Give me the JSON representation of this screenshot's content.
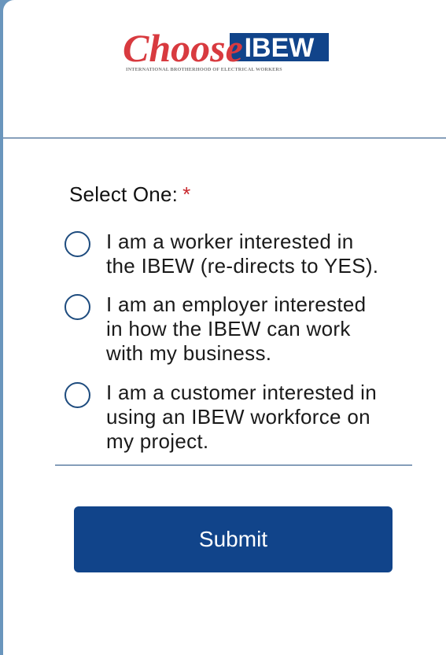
{
  "logo": {
    "script_text": "Choose",
    "brand_text": "IBEW",
    "tagline": "INTERNATIONAL BROTHERHOOD OF ELECTRICAL WORKERS",
    "script_color": "#d83a3f",
    "brand_color": "#11448a"
  },
  "form": {
    "prompt": "Select One:",
    "required_mark": "*",
    "options": [
      {
        "line1": "I am a worker interested in",
        "line2": "the IBEW (re-directs to YES).",
        "line3": ""
      },
      {
        "line1": "I am an employer interested",
        "line2": "in how the IBEW can work",
        "line3": "with my business."
      },
      {
        "line1": "I am a customer interested in",
        "line2": "using an IBEW workforce on",
        "line3": "my project."
      }
    ],
    "submit_label": "Submit"
  },
  "colors": {
    "primary": "#11448a",
    "required": "#c8282d",
    "frame": "#6a96bd"
  }
}
